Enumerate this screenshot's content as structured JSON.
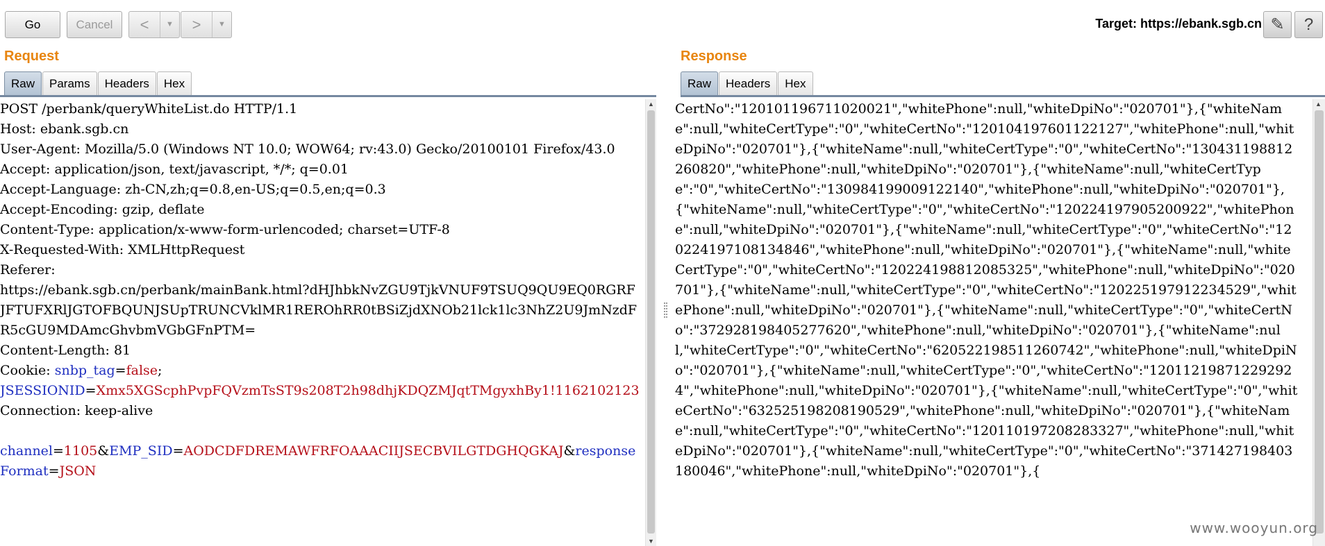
{
  "toolbar": {
    "go_label": "Go",
    "cancel_label": "Cancel",
    "back_icon": "<",
    "forward_icon": ">",
    "dropdown_icon": "▼",
    "target_label": "Target: https://ebank.sgb.cn",
    "edit_icon": "✎",
    "help_icon": "?"
  },
  "request": {
    "title": "Request",
    "tabs": [
      "Raw",
      "Params",
      "Headers",
      "Hex"
    ],
    "active_tab": "Raw",
    "raw": {
      "request_line": "POST /perbank/queryWhiteList.do HTTP/1.1",
      "headers": [
        "Host: ebank.sgb.cn",
        "User-Agent: Mozilla/5.0 (Windows NT 10.0; WOW64; rv:43.0) Gecko/20100101 Firefox/43.0",
        "Accept: application/json, text/javascript, */*; q=0.01",
        "Accept-Language: zh-CN,zh;q=0.8,en-US;q=0.5,en;q=0.3",
        "Accept-Encoding: gzip, deflate",
        "Content-Type: application/x-www-form-urlencoded; charset=UTF-8",
        "X-Requested-With: XMLHttpRequest",
        "Referer:",
        "https://ebank.sgb.cn/perbank/mainBank.html?dHJhbkNvZGU9TjkVNUF9TSUQ9QU9EQ0RGRFJFTUFXRlJGTOFBQUNJSUpTRUNCVklMR1REROhRR0tBSiZjdXNOb21lck1lc3NhZ2U9JmNzdFR5cGU9MDAmcGhvbmVGbGFnPTM=",
        "Content-Length: 81"
      ],
      "cookie_label": "Cookie: ",
      "cookie_key_1": "snbp_tag",
      "cookie_eq_1": "=",
      "cookie_val_1": "false",
      "cookie_sep": ";",
      "cookie_key_2": "JSESSIONID",
      "cookie_eq_2": "=",
      "cookie_val_2": "Xmx5XGScphPvpFQVzmTsST9s208T2h98dhjKDQZMJqtTMgyxhBy1!1162102123",
      "connection": "Connection: keep-alive",
      "body_key_1": "channel",
      "body_val_1": "1105",
      "body_key_2": "EMP_SID",
      "body_val_2": "AODCDFDREMAWFRFOAAACIIJSECBVILGTDGHQGKAJ",
      "body_key_3": "responseFormat",
      "body_val_3": "JSON",
      "eq": "=",
      "amp": "&"
    }
  },
  "response": {
    "title": "Response",
    "tabs": [
      "Raw",
      "Headers",
      "Hex"
    ],
    "active_tab": "Raw",
    "raw": "CertNo\":\"120101196711020021\",\"whitePhone\":null,\"whiteDpiNo\":\"020701\"},{\"whiteName\":null,\"whiteCertType\":\"0\",\"whiteCertNo\":\"120104197601122127\",\"whitePhone\":null,\"whiteDpiNo\":\"020701\"},{\"whiteName\":null,\"whiteCertType\":\"0\",\"whiteCertNo\":\"130431198812260820\",\"whitePhone\":null,\"whiteDpiNo\":\"020701\"},{\"whiteName\":null,\"whiteCertType\":\"0\",\"whiteCertNo\":\"130984199009122140\",\"whitePhone\":null,\"whiteDpiNo\":\"020701\"},{\"whiteName\":null,\"whiteCertType\":\"0\",\"whiteCertNo\":\"120224197905200922\",\"whitePhone\":null,\"whiteDpiNo\":\"020701\"},{\"whiteName\":null,\"whiteCertType\":\"0\",\"whiteCertNo\":\"120224197108134846\",\"whitePhone\":null,\"whiteDpiNo\":\"020701\"},{\"whiteName\":null,\"whiteCertType\":\"0\",\"whiteCertNo\":\"120224198812085325\",\"whitePhone\":null,\"whiteDpiNo\":\"020701\"},{\"whiteName\":null,\"whiteCertType\":\"0\",\"whiteCertNo\":\"120225197912234529\",\"whitePhone\":null,\"whiteDpiNo\":\"020701\"},{\"whiteName\":null,\"whiteCertType\":\"0\",\"whiteCertNo\":\"372928198405277620\",\"whitePhone\":null,\"whiteDpiNo\":\"020701\"},{\"whiteName\":null,\"whiteCertType\":\"0\",\"whiteCertNo\":\"620522198511260742\",\"whitePhone\":null,\"whiteDpiNo\":\"020701\"},{\"whiteName\":null,\"whiteCertType\":\"0\",\"whiteCertNo\":\"120112198712292924\",\"whitePhone\":null,\"whiteDpiNo\":\"020701\"},{\"whiteName\":null,\"whiteCertType\":\"0\",\"whiteCertNo\":\"632525198208190529\",\"whitePhone\":null,\"whiteDpiNo\":\"020701\"},{\"whiteName\":null,\"whiteCertType\":\"0\",\"whiteCertNo\":\"120110197208283327\",\"whitePhone\":null,\"whiteDpiNo\":\"020701\"},{\"whiteName\":null,\"whiteCertType\":\"0\",\"whiteCertNo\":\"371427198403180046\",\"whitePhone\":null,\"whiteDpiNo\":\"020701\"},{"
  },
  "watermark": "www.wooyun.org"
}
